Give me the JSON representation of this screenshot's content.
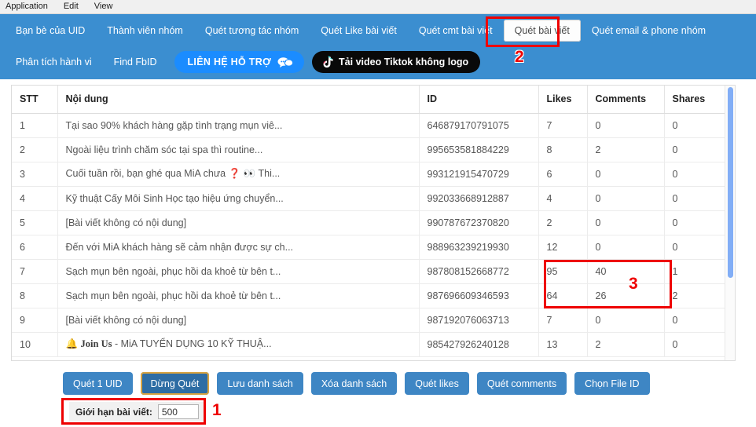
{
  "menubar": {
    "items": [
      {
        "label": "Application"
      },
      {
        "label": "Edit"
      },
      {
        "label": "View"
      }
    ]
  },
  "navbar": {
    "row1": [
      {
        "label": "Bạn bè của UID",
        "active": false
      },
      {
        "label": "Thành viên nhóm",
        "active": false
      },
      {
        "label": "Quét tương tác nhóm",
        "active": false
      },
      {
        "label": "Quét Like bài viết",
        "active": false
      },
      {
        "label": "Quét cmt bài viết",
        "active": false
      },
      {
        "label": "Quét bài viết",
        "active": true
      },
      {
        "label": "Quét email & phone nhóm",
        "active": false
      }
    ],
    "row2": [
      {
        "label": "Phân tích hành vi"
      },
      {
        "label": "Find FbID"
      }
    ],
    "support_button": {
      "label": "LIÊN HỆ HỖ TRỢ",
      "icon": "chat-bubbles-icon",
      "color": "#1b8cff"
    },
    "tiktok_button": {
      "label": "Tải video Tiktok không logo",
      "icon": "tiktok-note-icon",
      "color": "#090909"
    }
  },
  "table": {
    "columns": [
      "STT",
      "Nội dung",
      "ID",
      "Likes",
      "Comments",
      "Shares"
    ],
    "rows": [
      {
        "stt": "1",
        "noidung": "Tại sao 90% khách hàng gặp tình trạng mụn viê...",
        "id": "646879170791075",
        "likes": "7",
        "comments": "0",
        "shares": "0"
      },
      {
        "stt": "2",
        "noidung": "Ngoài liệu trình chăm sóc tại spa thì routine...",
        "id": "995653581884229",
        "likes": "8",
        "comments": "2",
        "shares": "0"
      },
      {
        "stt": "3",
        "noidung": "Cuối tuần rồi, bạn ghé qua MiA chưa ❓ 👀 Thi...",
        "id": "993121915470729",
        "likes": "6",
        "comments": "0",
        "shares": "0"
      },
      {
        "stt": "4",
        "noidung": "Kỹ thuật Cấy Môi Sinh Học tạo hiệu ứng chuyển...",
        "id": "992033668912887",
        "likes": "4",
        "comments": "0",
        "shares": "0"
      },
      {
        "stt": "5",
        "noidung": "[Bài viết không có nội dung]",
        "id": "990787672370820",
        "likes": "2",
        "comments": "0",
        "shares": "0"
      },
      {
        "stt": "6",
        "noidung": "Đến với MiA khách hàng sẽ cảm nhận được sự ch...",
        "id": "988963239219930",
        "likes": "12",
        "comments": "0",
        "shares": "0"
      },
      {
        "stt": "7",
        "noidung": "Sạch mụn bên ngoài, phục hồi da khoẻ từ bên t...",
        "id": "987808152668772",
        "likes": "95",
        "comments": "40",
        "shares": "1"
      },
      {
        "stt": "8",
        "noidung": "Sạch mụn bên ngoài, phục hồi da khoẻ từ bên t...",
        "id": "987696609346593",
        "likes": "64",
        "comments": "26",
        "shares": "2"
      },
      {
        "stt": "9",
        "noidung": "[Bài viết không có nội dung]",
        "id": "987192076063713",
        "likes": "7",
        "comments": "0",
        "shares": "0"
      },
      {
        "stt": "10",
        "noidung": "🔔 Join Us - MiA TUYỂN DỤNG 10 KỸ THUẬ...",
        "id": "985427926240128",
        "likes": "13",
        "comments": "2",
        "shares": "0"
      }
    ]
  },
  "buttons": [
    {
      "label": "Quét 1 UID",
      "focused": false
    },
    {
      "label": "Dừng Quét",
      "focused": true
    },
    {
      "label": "Lưu danh sách",
      "focused": false
    },
    {
      "label": "Xóa danh sách",
      "focused": false
    },
    {
      "label": "Quét likes",
      "focused": false
    },
    {
      "label": "Quét comments",
      "focused": false
    },
    {
      "label": "Chọn File ID",
      "focused": false
    }
  ],
  "limit_field": {
    "label": "Giới hạn bài viết:",
    "value": "500"
  },
  "annotations": [
    {
      "number": "1"
    },
    {
      "number": "2"
    },
    {
      "number": "3"
    }
  ],
  "colors": {
    "nav_blue": "#3b8ed0",
    "button_blue": "#3e86c4",
    "annotation_red": "#ee0000",
    "scrollbar_blue": "#82aef6"
  }
}
